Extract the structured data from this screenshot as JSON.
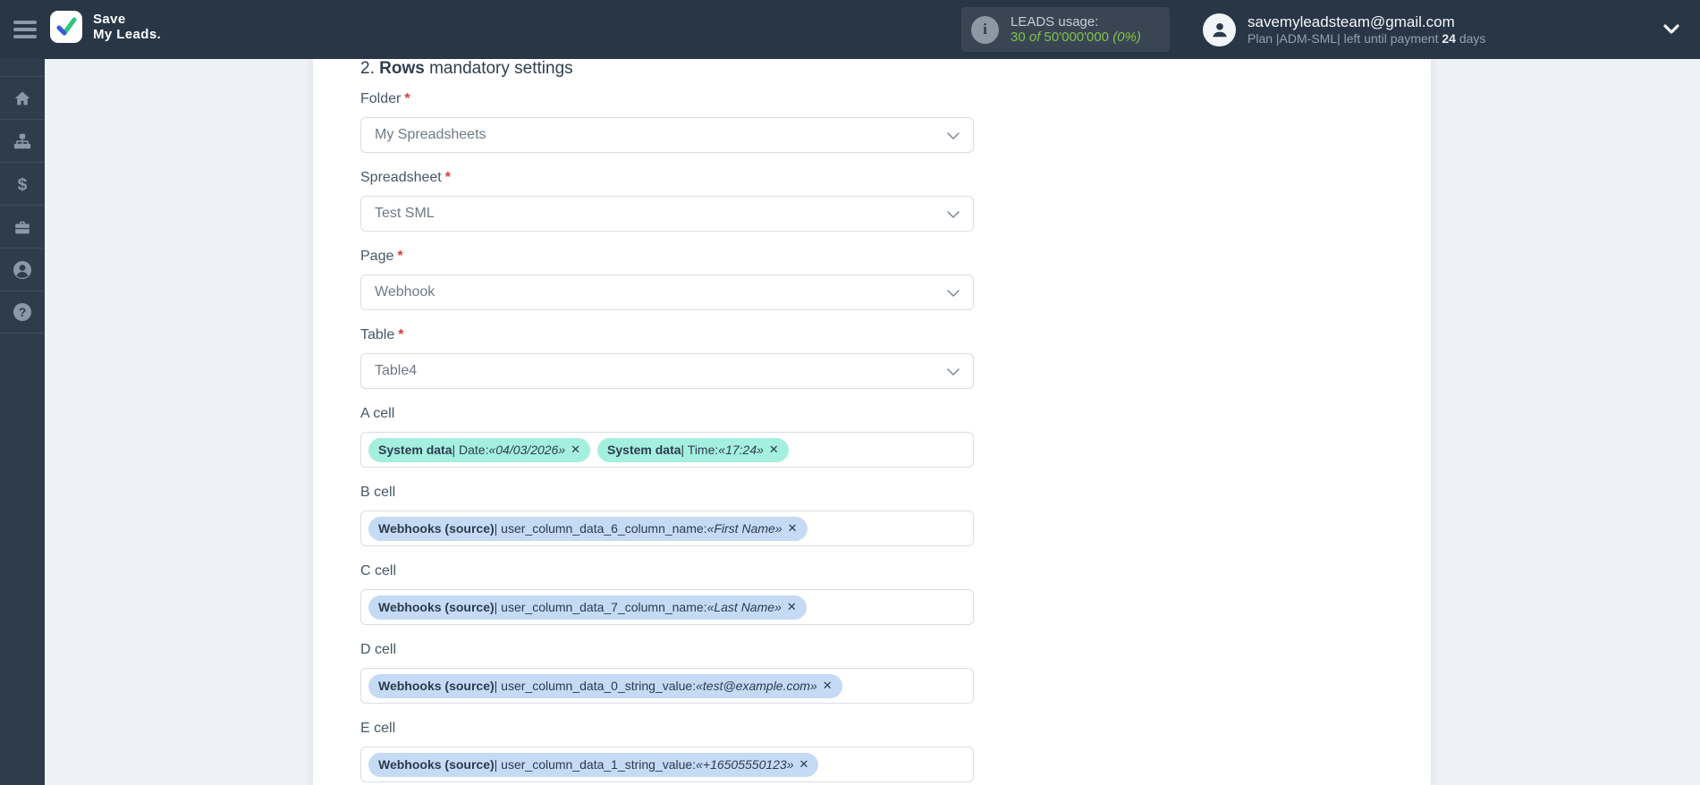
{
  "ui": {
    "required_glyph": "*",
    "close_glyph": "✕",
    "separator": "|",
    "dollar_glyph": "$",
    "help_glyph": "?",
    "info_glyph": "i"
  },
  "colors": {
    "header_bg": "#283646",
    "sidebar_bg": "#2e3c4c",
    "leads_box_bg": "#3a4554",
    "accent_green": "#82c14b",
    "teal_pill": "#a5efdf",
    "blue_pill": "#c5daf4",
    "asterisk_red": "#d93a3a",
    "card_bg": "#ffffff",
    "page_bg": "#eef1f6"
  },
  "header": {
    "logo": {
      "line1": "Save",
      "line2": "My Leads."
    },
    "leads": {
      "label": "LEADS usage:",
      "used": "30",
      "of": "of",
      "total": "50'000'000",
      "percent": "(0%)"
    },
    "account": {
      "email": "savemyleadsteam@gmail.com",
      "plan_prefix": "Plan |ADM-SML| left until payment",
      "days": "24",
      "days_suffix": "days"
    }
  },
  "sidebar": {
    "items": [
      "home-icon",
      "sitemap-icon",
      "dollar-icon",
      "briefcase-icon",
      "profile-icon",
      "help-icon"
    ]
  },
  "main": {
    "heading": {
      "num": "2.",
      "bold": "Rows",
      "rest": "mandatory settings"
    },
    "fields": [
      {
        "label": "Folder",
        "required": true,
        "type": "select",
        "value": "My Spreadsheets"
      },
      {
        "label": "Spreadsheet",
        "required": true,
        "type": "select",
        "value": "Test SML"
      },
      {
        "label": "Page",
        "required": true,
        "type": "select",
        "value": "Webhook"
      },
      {
        "label": "Table",
        "required": true,
        "type": "select",
        "value": "Table4"
      },
      {
        "label": "A cell",
        "required": false,
        "type": "tags",
        "tags": [
          {
            "color": "teal",
            "source": "System data",
            "field": "Date:",
            "value": "«04/03/2026»"
          },
          {
            "color": "teal",
            "source": "System data",
            "field": "Time:",
            "value": "«17:24»"
          }
        ]
      },
      {
        "label": "B cell",
        "required": false,
        "type": "tags",
        "tags": [
          {
            "color": "blue",
            "source": "Webhooks (source)",
            "field": "user_column_data_6_column_name:",
            "value": "«First Name»"
          }
        ]
      },
      {
        "label": "C cell",
        "required": false,
        "type": "tags",
        "tags": [
          {
            "color": "blue",
            "source": "Webhooks (source)",
            "field": "user_column_data_7_column_name:",
            "value": "«Last Name»"
          }
        ]
      },
      {
        "label": "D cell",
        "required": false,
        "type": "tags",
        "tags": [
          {
            "color": "blue",
            "source": "Webhooks (source)",
            "field": "user_column_data_0_string_value:",
            "value": "«test@example.com»"
          }
        ]
      },
      {
        "label": "E cell",
        "required": false,
        "type": "tags",
        "tags": [
          {
            "color": "blue",
            "source": "Webhooks (source)",
            "field": "user_column_data_1_string_value:",
            "value": "«+16505550123»"
          }
        ]
      }
    ]
  }
}
